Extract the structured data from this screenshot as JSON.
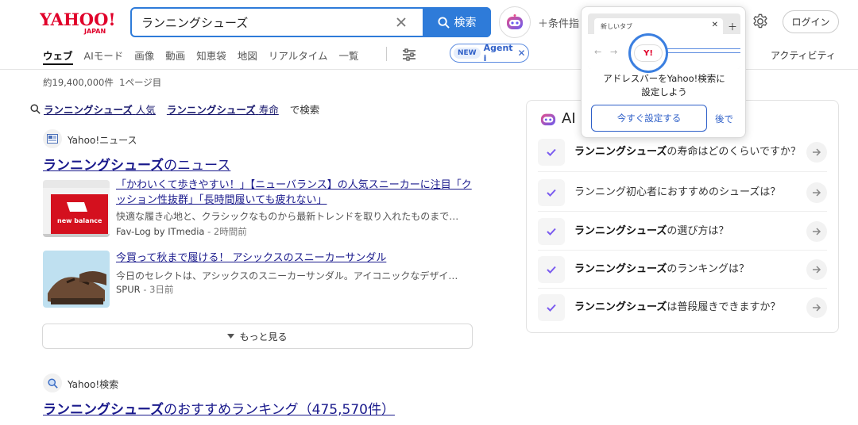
{
  "logo": {
    "main": "YAHOO!",
    "sub": "JAPAN"
  },
  "search": {
    "query": "ランニングシューズ",
    "button_label": "検索"
  },
  "header": {
    "conditions": "条件指",
    "login_label": "ログイン"
  },
  "tabs": [
    {
      "label": "ウェブ",
      "active": true
    },
    {
      "label": "AIモード"
    },
    {
      "label": "画像"
    },
    {
      "label": "動画"
    },
    {
      "label": "知恵袋"
    },
    {
      "label": "地図"
    },
    {
      "label": "リアルタイム"
    },
    {
      "label": "一覧"
    }
  ],
  "agent_badge": {
    "new": "NEW",
    "label": "Agent i"
  },
  "activity_label": "アクティビティ",
  "results": {
    "count": "約19,400,000件",
    "page": "1ページ目",
    "suggest": [
      {
        "word": "ランニングシューズ",
        "extra": "人気"
      },
      {
        "word": "ランニングシューズ",
        "extra": "寿命"
      }
    ],
    "suggest_tail": "で検索"
  },
  "news": {
    "source": "Yahoo!ニュース",
    "heading_bold": "ランニングシューズ",
    "heading_rest": "のニュース",
    "articles": [
      {
        "title": "「かわいくて歩きやすい！」【ニューバランス】の人気スニーカーに注目「クッション性抜群」「長時間履いても疲れない」",
        "snippet": "快適な履き心地と、クラシックなものから最新トレンドを取り入れたものまで…",
        "source": "Fav-Log by ITmedia",
        "ago": "2時間前",
        "thumb_text": "new balance"
      },
      {
        "title": "今買って秋まで履ける！ アシックスのスニーカーサンダル",
        "snippet": "今日のセレクトは、アシックスのスニーカーサンダル。アイコニックなデザイ…",
        "source": "SPUR",
        "ago": "3日前"
      }
    ],
    "more_label": "もっと見る"
  },
  "search_block": {
    "source": "Yahoo!検索",
    "heading_bold": "ランニングシューズ",
    "heading_rest": "のおすすめランキング（475,570件）"
  },
  "ai_panel": {
    "title": "AI",
    "questions": [
      {
        "bold": "ランニングシューズ",
        "rest": "の寿命はどのくらいですか？"
      },
      {
        "bold": "",
        "rest": "ランニング初心者におすすめのシューズは？"
      },
      {
        "bold": "ランニングシューズ",
        "rest": "の選び方は？"
      },
      {
        "bold": "ランニングシューズ",
        "rest": "のランキングは？"
      },
      {
        "bold": "ランニングシューズ",
        "rest": "は普段履きできますか？"
      }
    ]
  },
  "popup": {
    "tab_label": "新しいタブ",
    "badge": "Y!",
    "message_line1": "アドレスバーをYahoo!検索に",
    "message_line2": "設定しよう",
    "primary_label": "今すぐ設定する",
    "later_label": "後で"
  },
  "colors": {
    "brand_red": "#e0002a",
    "accent_blue": "#2e7bd9",
    "link": "#1a1a8c",
    "ai_purple": "#7b5cf0"
  }
}
